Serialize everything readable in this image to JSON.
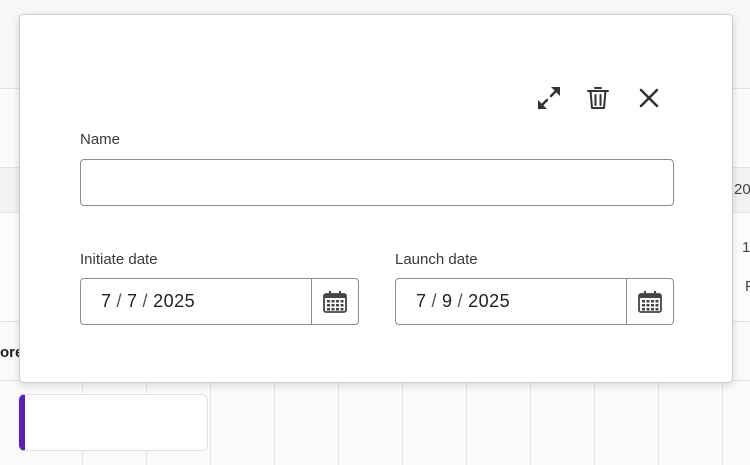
{
  "background": {
    "partial_texts": [
      "20",
      "1",
      "F",
      "ore"
    ]
  },
  "popover": {
    "icons": [
      "expand-icon",
      "trash-icon",
      "close-icon"
    ],
    "name_field": {
      "label": "Name",
      "value": "",
      "placeholder": ""
    },
    "initiate_date": {
      "label": "Initiate date",
      "month": "7",
      "day": "7",
      "year": "2025"
    },
    "launch_date": {
      "label": "Launch date",
      "month": "7",
      "day": "9",
      "year": "2025"
    }
  },
  "colors": {
    "accent_bar": "#5c1fbf",
    "border": "#8e8e8e"
  }
}
